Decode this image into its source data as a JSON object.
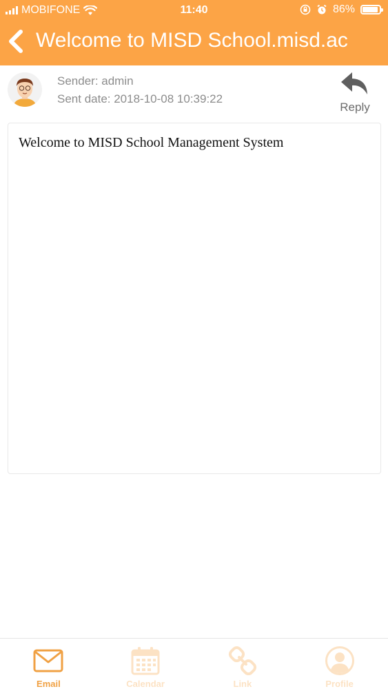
{
  "status_bar": {
    "carrier": "MOBIFONE",
    "time": "11:40",
    "battery": "86%"
  },
  "header": {
    "title": "Welcome to MISD School.misd.ac"
  },
  "message": {
    "sender": "Sender: admin",
    "sent_date": "Sent date: 2018-10-08 10:39:22",
    "reply_label": "Reply",
    "body": "Welcome to MISD School Management System"
  },
  "tabs": [
    {
      "label": "Email",
      "icon": "envelope-icon",
      "active": true
    },
    {
      "label": "Calendar",
      "icon": "calendar-icon",
      "active": false
    },
    {
      "label": "Link",
      "icon": "link-icon",
      "active": false
    },
    {
      "label": "Profile",
      "icon": "profile-icon",
      "active": false
    }
  ],
  "colors": {
    "accent": "#FCA446",
    "tab_active": "#F0A144",
    "tab_inactive": "#FCE2C4"
  }
}
